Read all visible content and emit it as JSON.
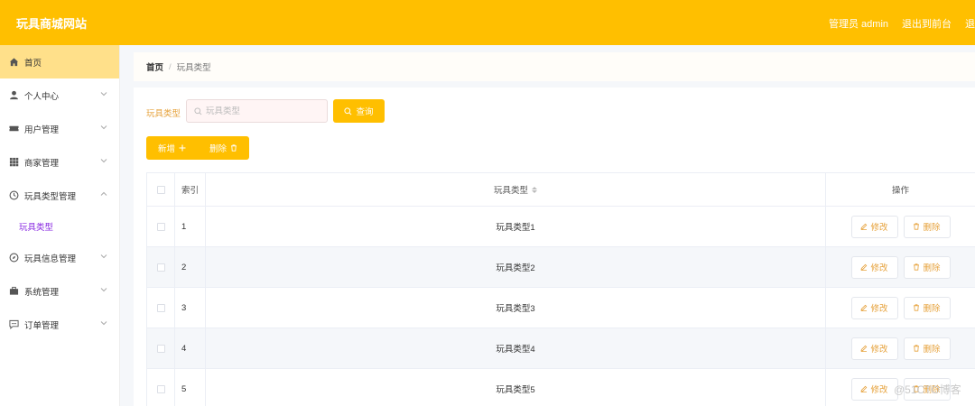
{
  "header": {
    "brand": "玩具商城网站",
    "admin_label": "管理员 admin",
    "frontend_link": "退出到前台",
    "logout_link": "退"
  },
  "sidebar": {
    "items": [
      {
        "label": "首页",
        "icon": "home-icon"
      },
      {
        "label": "个人中心",
        "icon": "user-icon"
      },
      {
        "label": "用户管理",
        "icon": "ticket-icon"
      },
      {
        "label": "商家管理",
        "icon": "grid-icon"
      },
      {
        "label": "玩具类型管理",
        "icon": "clock-icon"
      },
      {
        "label": "玩具信息管理",
        "icon": "compass-icon"
      },
      {
        "label": "系统管理",
        "icon": "briefcase-icon"
      },
      {
        "label": "订单管理",
        "icon": "chat-icon"
      }
    ],
    "sub_item": "玩具类型"
  },
  "breadcrumb": {
    "home": "首页",
    "separator": "/",
    "current": "玩具类型"
  },
  "search": {
    "label": "玩具类型",
    "placeholder": "玩具类型",
    "button": "查询"
  },
  "actions": {
    "add": "新增",
    "delete": "删除"
  },
  "table": {
    "columns": {
      "index": "索引",
      "type": "玩具类型",
      "ops": "操作"
    },
    "edit_label": "修改",
    "delete_label": "删除",
    "rows": [
      {
        "index": "1",
        "type": "玩具类型1"
      },
      {
        "index": "2",
        "type": "玩具类型2"
      },
      {
        "index": "3",
        "type": "玩具类型3"
      },
      {
        "index": "4",
        "type": "玩具类型4"
      },
      {
        "index": "5",
        "type": "玩具类型5"
      }
    ]
  },
  "watermark": "@51CTO博客",
  "colors": {
    "accent": "#ffbf00",
    "active_bg": "#ffe08a",
    "sub_text": "#8a2be2",
    "op_text": "#e6a23c"
  }
}
